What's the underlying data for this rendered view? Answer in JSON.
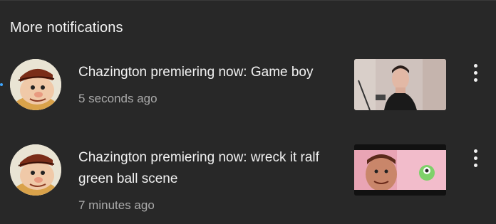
{
  "section": {
    "title": "More notifications"
  },
  "notifications": [
    {
      "title": "Chazington premiering now: Game boy",
      "time": "5 seconds ago",
      "unread": true,
      "avatar_icon": "channel-avatar-cartoon",
      "thumbnail_icon": "video-thumbnail-webcam",
      "menu_icon": "more-vert-icon"
    },
    {
      "title": "Chazington premiering now: wreck it ralf green ball scene",
      "time": "7 minutes ago",
      "unread": false,
      "avatar_icon": "channel-avatar-cartoon",
      "thumbnail_icon": "video-thumbnail-animation",
      "menu_icon": "more-vert-icon"
    }
  ],
  "colors": {
    "background": "#282828",
    "text_primary": "#f1f1f1",
    "text_secondary": "#aaaaaa",
    "unread_dot": "#3ea6ff"
  }
}
